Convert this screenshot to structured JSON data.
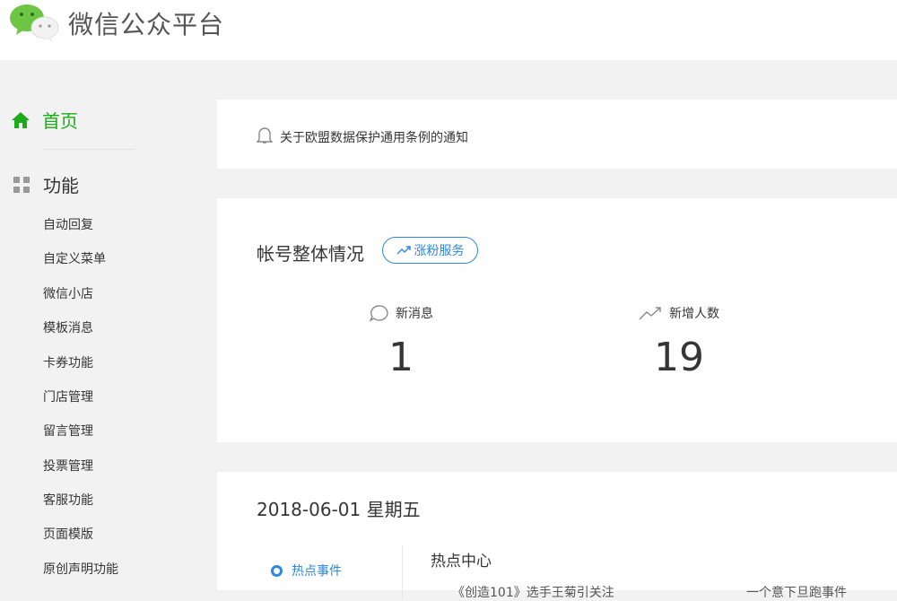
{
  "header": {
    "title": "微信公众平台"
  },
  "sidebar": {
    "home": "首页",
    "functions": "功能",
    "items": [
      "自动回复",
      "自定义菜单",
      "微信小店",
      "模板消息",
      "卡券功能",
      "门店管理",
      "留言管理",
      "投票管理",
      "客服功能",
      "页面模版",
      "原创声明功能"
    ]
  },
  "notice": {
    "text": "关于欧盟数据保护通用条例的通知"
  },
  "account": {
    "title": "帐号整体情况",
    "grow_button": "涨粉服务",
    "stats": [
      {
        "label": "新消息",
        "value": "1"
      },
      {
        "label": "新增人数",
        "value": "19"
      }
    ]
  },
  "daily": {
    "date": "2018-06-01 星期五",
    "tab": "热点事件",
    "hot_title": "热点中心",
    "hot_items": [
      "《创造101》选手王菊引关注",
      "一个意下旦跑事件"
    ]
  },
  "colors": {
    "brand": "#1aad19",
    "accent": "#2e86de"
  }
}
